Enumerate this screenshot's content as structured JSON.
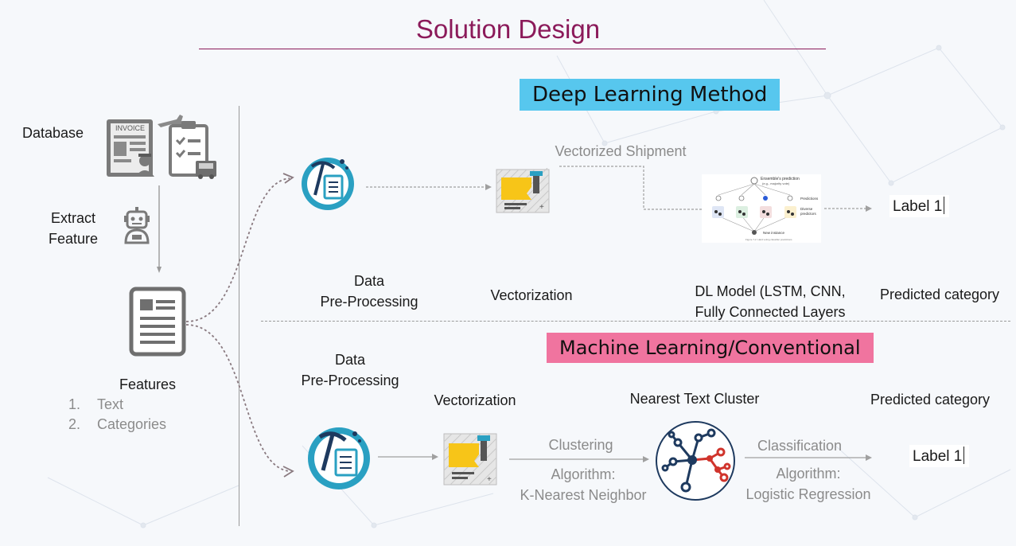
{
  "title": "Solution Design",
  "dl_banner": "Deep Learning Method",
  "ml_banner": "Machine Learning/Conventional",
  "left": {
    "database": "Database",
    "extract_line1": "Extract",
    "extract_line2": "Feature",
    "invoice_text": "INVOICE",
    "features": "Features",
    "feature_items": [
      {
        "num": "1.",
        "text": "Text"
      },
      {
        "num": "2.",
        "text": "Categories"
      }
    ]
  },
  "dl": {
    "preprocess_line1": "Data",
    "preprocess_line2": "Pre-Processing",
    "vectorization": "Vectorization",
    "vectorized_shipment": "Vectorized Shipment",
    "model_line1": "DL Model (LSTM, CNN,",
    "model_line2": "Fully Connected Layers",
    "predicted": "Predicted category",
    "label": "Label 1",
    "ensemble_title": "Ensemble's prediction",
    "ensemble_sub": "(e.g., majority vote)",
    "predictions": "Predictions",
    "diverse": "Diverse",
    "predictors": "predictors",
    "new_instance": "New instance",
    "figure_caption": "Figure 7-2. Hard voting classifier predictions"
  },
  "ml": {
    "preprocess_line1": "Data",
    "preprocess_line2": "Pre-Processing",
    "vectorization": "Vectorization",
    "nearest": "Nearest Text Cluster",
    "predicted": "Predicted category",
    "clustering": "Clustering",
    "clustering_alg1": "Algorithm:",
    "clustering_alg2": "K-Nearest Neighbor",
    "classification": "Classification",
    "classification_alg1": "Algorithm:",
    "classification_alg2": "Logistic Regression",
    "label": "Label 1"
  },
  "colors": {
    "title": "#8b1a5a",
    "dl_banner": "#57c7ee",
    "ml_banner": "#f0749f",
    "icon_teal": "#2aa0c2",
    "icon_yellow": "#f7c518",
    "cluster_red": "#d0342c",
    "cluster_navy": "#1e3a5f"
  },
  "icons": [
    "invoice-icon",
    "clipboard-plane-icon",
    "robot-icon",
    "document-icon",
    "data-mining-icon",
    "vectorize-icon",
    "ensemble-diagram",
    "cluster-network-icon"
  ]
}
